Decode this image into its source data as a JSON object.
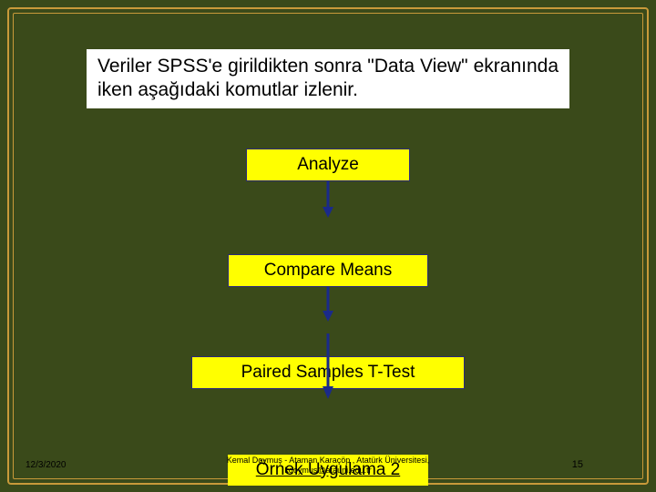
{
  "intro": "Veriler SPSS'e girildikten sonra \"Data View\" ekranında iken aşağıdaki komutlar izlenir.",
  "steps": {
    "analyze": "Analyze",
    "compare": "Compare Means",
    "paired": "Paired Samples T-Test"
  },
  "example_link": "Örnek Uygulama 2",
  "footer": {
    "date": "12/3/2020",
    "credit_line1": "Kemal Doymuş - Ataman Karaçöp , Atatürk Üniversitesi,",
    "credit_line2": "kdoymus@atauni.edu.tr",
    "page": "15"
  },
  "chart_data": {
    "type": "diagram",
    "flow": [
      "Analyze",
      "Compare Means",
      "Paired Samples T-Test"
    ],
    "terminal": "Örnek Uygulama 2",
    "description": "Sequential menu navigation in SPSS for Paired Samples T-Test"
  }
}
